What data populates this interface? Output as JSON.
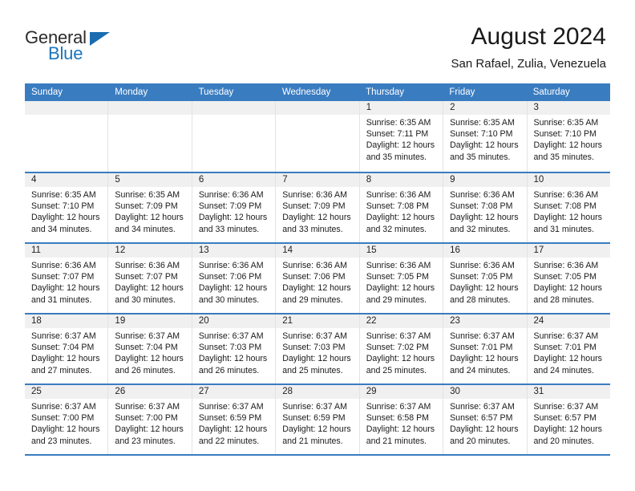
{
  "brand": {
    "name_part1": "General",
    "name_part2": "Blue",
    "triangle_color": "#1b6cb0",
    "blue_text_color": "#1b75bb"
  },
  "header": {
    "title": "August 2024",
    "subtitle": "San Rafael, Zulia, Venezuela"
  },
  "colors": {
    "header_blue": "#3a7cc0",
    "day_number_band": "#f0f0f0",
    "cell_divider": "#e3e3e3"
  },
  "weekdays": [
    "Sunday",
    "Monday",
    "Tuesday",
    "Wednesday",
    "Thursday",
    "Friday",
    "Saturday"
  ],
  "weeks": [
    [
      {
        "day": "",
        "sunrise": "",
        "sunset": "",
        "daylight_line1": "",
        "daylight_line2": "",
        "empty": true
      },
      {
        "day": "",
        "sunrise": "",
        "sunset": "",
        "daylight_line1": "",
        "daylight_line2": "",
        "empty": true
      },
      {
        "day": "",
        "sunrise": "",
        "sunset": "",
        "daylight_line1": "",
        "daylight_line2": "",
        "empty": true
      },
      {
        "day": "",
        "sunrise": "",
        "sunset": "",
        "daylight_line1": "",
        "daylight_line2": "",
        "empty": true
      },
      {
        "day": "1",
        "sunrise": "Sunrise: 6:35 AM",
        "sunset": "Sunset: 7:11 PM",
        "daylight_line1": "Daylight: 12 hours",
        "daylight_line2": "and 35 minutes."
      },
      {
        "day": "2",
        "sunrise": "Sunrise: 6:35 AM",
        "sunset": "Sunset: 7:10 PM",
        "daylight_line1": "Daylight: 12 hours",
        "daylight_line2": "and 35 minutes."
      },
      {
        "day": "3",
        "sunrise": "Sunrise: 6:35 AM",
        "sunset": "Sunset: 7:10 PM",
        "daylight_line1": "Daylight: 12 hours",
        "daylight_line2": "and 35 minutes."
      }
    ],
    [
      {
        "day": "4",
        "sunrise": "Sunrise: 6:35 AM",
        "sunset": "Sunset: 7:10 PM",
        "daylight_line1": "Daylight: 12 hours",
        "daylight_line2": "and 34 minutes."
      },
      {
        "day": "5",
        "sunrise": "Sunrise: 6:35 AM",
        "sunset": "Sunset: 7:09 PM",
        "daylight_line1": "Daylight: 12 hours",
        "daylight_line2": "and 34 minutes."
      },
      {
        "day": "6",
        "sunrise": "Sunrise: 6:36 AM",
        "sunset": "Sunset: 7:09 PM",
        "daylight_line1": "Daylight: 12 hours",
        "daylight_line2": "and 33 minutes."
      },
      {
        "day": "7",
        "sunrise": "Sunrise: 6:36 AM",
        "sunset": "Sunset: 7:09 PM",
        "daylight_line1": "Daylight: 12 hours",
        "daylight_line2": "and 33 minutes."
      },
      {
        "day": "8",
        "sunrise": "Sunrise: 6:36 AM",
        "sunset": "Sunset: 7:08 PM",
        "daylight_line1": "Daylight: 12 hours",
        "daylight_line2": "and 32 minutes."
      },
      {
        "day": "9",
        "sunrise": "Sunrise: 6:36 AM",
        "sunset": "Sunset: 7:08 PM",
        "daylight_line1": "Daylight: 12 hours",
        "daylight_line2": "and 32 minutes."
      },
      {
        "day": "10",
        "sunrise": "Sunrise: 6:36 AM",
        "sunset": "Sunset: 7:08 PM",
        "daylight_line1": "Daylight: 12 hours",
        "daylight_line2": "and 31 minutes."
      }
    ],
    [
      {
        "day": "11",
        "sunrise": "Sunrise: 6:36 AM",
        "sunset": "Sunset: 7:07 PM",
        "daylight_line1": "Daylight: 12 hours",
        "daylight_line2": "and 31 minutes."
      },
      {
        "day": "12",
        "sunrise": "Sunrise: 6:36 AM",
        "sunset": "Sunset: 7:07 PM",
        "daylight_line1": "Daylight: 12 hours",
        "daylight_line2": "and 30 minutes."
      },
      {
        "day": "13",
        "sunrise": "Sunrise: 6:36 AM",
        "sunset": "Sunset: 7:06 PM",
        "daylight_line1": "Daylight: 12 hours",
        "daylight_line2": "and 30 minutes."
      },
      {
        "day": "14",
        "sunrise": "Sunrise: 6:36 AM",
        "sunset": "Sunset: 7:06 PM",
        "daylight_line1": "Daylight: 12 hours",
        "daylight_line2": "and 29 minutes."
      },
      {
        "day": "15",
        "sunrise": "Sunrise: 6:36 AM",
        "sunset": "Sunset: 7:05 PM",
        "daylight_line1": "Daylight: 12 hours",
        "daylight_line2": "and 29 minutes."
      },
      {
        "day": "16",
        "sunrise": "Sunrise: 6:36 AM",
        "sunset": "Sunset: 7:05 PM",
        "daylight_line1": "Daylight: 12 hours",
        "daylight_line2": "and 28 minutes."
      },
      {
        "day": "17",
        "sunrise": "Sunrise: 6:36 AM",
        "sunset": "Sunset: 7:05 PM",
        "daylight_line1": "Daylight: 12 hours",
        "daylight_line2": "and 28 minutes."
      }
    ],
    [
      {
        "day": "18",
        "sunrise": "Sunrise: 6:37 AM",
        "sunset": "Sunset: 7:04 PM",
        "daylight_line1": "Daylight: 12 hours",
        "daylight_line2": "and 27 minutes."
      },
      {
        "day": "19",
        "sunrise": "Sunrise: 6:37 AM",
        "sunset": "Sunset: 7:04 PM",
        "daylight_line1": "Daylight: 12 hours",
        "daylight_line2": "and 26 minutes."
      },
      {
        "day": "20",
        "sunrise": "Sunrise: 6:37 AM",
        "sunset": "Sunset: 7:03 PM",
        "daylight_line1": "Daylight: 12 hours",
        "daylight_line2": "and 26 minutes."
      },
      {
        "day": "21",
        "sunrise": "Sunrise: 6:37 AM",
        "sunset": "Sunset: 7:03 PM",
        "daylight_line1": "Daylight: 12 hours",
        "daylight_line2": "and 25 minutes."
      },
      {
        "day": "22",
        "sunrise": "Sunrise: 6:37 AM",
        "sunset": "Sunset: 7:02 PM",
        "daylight_line1": "Daylight: 12 hours",
        "daylight_line2": "and 25 minutes."
      },
      {
        "day": "23",
        "sunrise": "Sunrise: 6:37 AM",
        "sunset": "Sunset: 7:01 PM",
        "daylight_line1": "Daylight: 12 hours",
        "daylight_line2": "and 24 minutes."
      },
      {
        "day": "24",
        "sunrise": "Sunrise: 6:37 AM",
        "sunset": "Sunset: 7:01 PM",
        "daylight_line1": "Daylight: 12 hours",
        "daylight_line2": "and 24 minutes."
      }
    ],
    [
      {
        "day": "25",
        "sunrise": "Sunrise: 6:37 AM",
        "sunset": "Sunset: 7:00 PM",
        "daylight_line1": "Daylight: 12 hours",
        "daylight_line2": "and 23 minutes."
      },
      {
        "day": "26",
        "sunrise": "Sunrise: 6:37 AM",
        "sunset": "Sunset: 7:00 PM",
        "daylight_line1": "Daylight: 12 hours",
        "daylight_line2": "and 23 minutes."
      },
      {
        "day": "27",
        "sunrise": "Sunrise: 6:37 AM",
        "sunset": "Sunset: 6:59 PM",
        "daylight_line1": "Daylight: 12 hours",
        "daylight_line2": "and 22 minutes."
      },
      {
        "day": "28",
        "sunrise": "Sunrise: 6:37 AM",
        "sunset": "Sunset: 6:59 PM",
        "daylight_line1": "Daylight: 12 hours",
        "daylight_line2": "and 21 minutes."
      },
      {
        "day": "29",
        "sunrise": "Sunrise: 6:37 AM",
        "sunset": "Sunset: 6:58 PM",
        "daylight_line1": "Daylight: 12 hours",
        "daylight_line2": "and 21 minutes."
      },
      {
        "day": "30",
        "sunrise": "Sunrise: 6:37 AM",
        "sunset": "Sunset: 6:57 PM",
        "daylight_line1": "Daylight: 12 hours",
        "daylight_line2": "and 20 minutes."
      },
      {
        "day": "31",
        "sunrise": "Sunrise: 6:37 AM",
        "sunset": "Sunset: 6:57 PM",
        "daylight_line1": "Daylight: 12 hours",
        "daylight_line2": "and 20 minutes."
      }
    ]
  ]
}
